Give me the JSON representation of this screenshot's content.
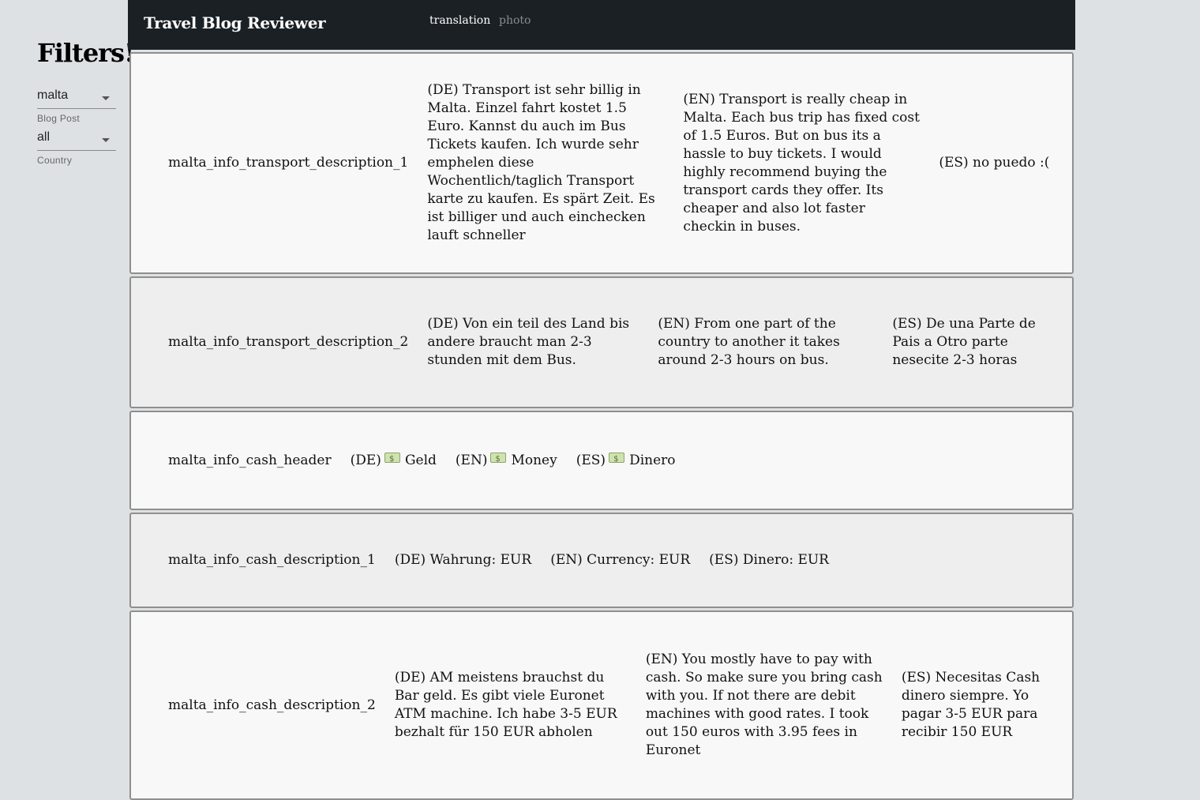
{
  "app": {
    "title": "Travel Blog Reviewer",
    "tabs": [
      {
        "label": "translation",
        "active": true
      },
      {
        "label": "photo",
        "active": false
      }
    ]
  },
  "sidebar": {
    "heading": "Filters!",
    "filters": [
      {
        "value": "malta",
        "label": "Blog Post"
      },
      {
        "value": "all",
        "label": "Country"
      }
    ]
  },
  "rows": [
    {
      "key": "malta_info_transport_description_1",
      "de": "(DE) Transport ist sehr billig in Malta. Einzel fahrt kostet 1.5 Euro. Kannst du auch im Bus Tickets kaufen. Ich wurde sehr emphelen diese Wochentlich/taglich Transport karte zu kaufen. Es spärt Zeit. Es ist billiger und auch einchecken lauft schneller",
      "en": "(EN) Transport is really cheap in Malta. Each bus trip has fixed cost of 1.5 Euros. But on bus its a hassle to buy tickets. I would highly recommend buying the transport cards they offer. Its cheaper and also lot faster checkin in buses.",
      "es": "(ES) no puedo :("
    },
    {
      "key": "malta_info_transport_description_2",
      "de": "(DE) Von ein teil des Land bis andere braucht man 2-3 stunden mit dem Bus.",
      "en": "(EN) From one part of the country to another it takes around 2-3 hours on bus.",
      "es": "(ES) De una Parte de Pais a Otro parte nesecite 2-3 horas"
    },
    {
      "key": "malta_info_cash_header",
      "de_prefix": "(DE)",
      "de_text": "Geld",
      "en_prefix": "(EN)",
      "en_text": "Money",
      "es_prefix": "(ES)",
      "es_text": "Dinero",
      "icon": "money-icon"
    },
    {
      "key": "malta_info_cash_description_1",
      "de": "(DE) Wahrung: EUR",
      "en": "(EN) Currency: EUR",
      "es": "(ES) Dinero: EUR"
    },
    {
      "key": "malta_info_cash_description_2",
      "de": "(DE) AM meistens brauchst du Bar geld. Es gibt viele Euronet ATM machine. Ich habe 3-5 EUR bezhalt für 150 EUR abholen",
      "en": "(EN) You mostly have to pay with cash. So make sure you bring cash with you. If not there are debit machines with good rates. I took out 150 euros with 3.95 fees in Euronet",
      "es": "(ES) Necesitas Cash dinero siempre. Yo pagar 3-5 EUR para recibir 150 EUR"
    }
  ]
}
